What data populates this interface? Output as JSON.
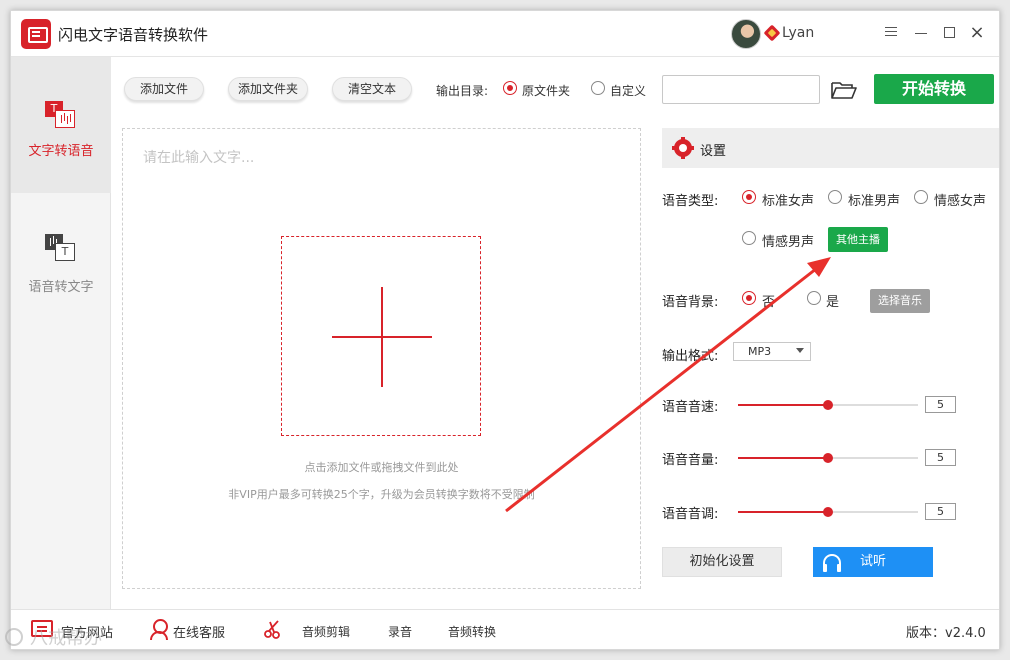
{
  "window": {
    "title": "闪电文字语音转换软件",
    "user_name": "Lyan"
  },
  "sidebar": {
    "items": [
      {
        "label": "文字转语音",
        "active": true,
        "icon": "text-to-speech-icon"
      },
      {
        "label": "语音转文字",
        "active": false,
        "icon": "speech-to-text-icon"
      }
    ]
  },
  "toolbar": {
    "add_file": "添加文件",
    "add_folder": "添加文件夹",
    "clear_text": "清空文本",
    "output_dir_label": "输出目录:",
    "output_options": [
      "原文件夹",
      "自定义"
    ],
    "output_selected": "原文件夹",
    "path_value": "",
    "start_label": "开始转换"
  },
  "editor": {
    "placeholder": "请在此输入文字...",
    "drop_hint": "点击添加文件或拖拽文件到此处",
    "vip_hint": "非VIP用户最多可转换25个字，升级为会员转换字数将不受限制"
  },
  "settings": {
    "title": "设置",
    "voice_type_label": "语音类型:",
    "voice_options": [
      "标准女声",
      "标准男声",
      "情感女声",
      "情感男声"
    ],
    "voice_selected": "标准女声",
    "other_anchor": "其他主播",
    "bg_label": "语音背景:",
    "bg_options": [
      "否",
      "是"
    ],
    "bg_selected": "否",
    "choose_music": "选择音乐",
    "format_label": "输出格式:",
    "format_value": "MP3",
    "sliders": [
      {
        "label": "语音音速:",
        "value": "5",
        "fraction": 0.5
      },
      {
        "label": "语音音量:",
        "value": "5",
        "fraction": 0.5
      },
      {
        "label": "语音音调:",
        "value": "5",
        "fraction": 0.5
      }
    ],
    "reset": "初始化设置",
    "listen": "试听"
  },
  "footer": {
    "website": "官方网站",
    "service": "在线客服",
    "audio_edit": "音频剪辑",
    "record": "录音",
    "audio_convert": "音频转换",
    "version": "版本：v2.4.0"
  },
  "watermark": "八戒帮办",
  "colors": {
    "accent": "#d8232a",
    "primary_green": "#1aa84a",
    "listen_blue": "#1e90f5"
  }
}
